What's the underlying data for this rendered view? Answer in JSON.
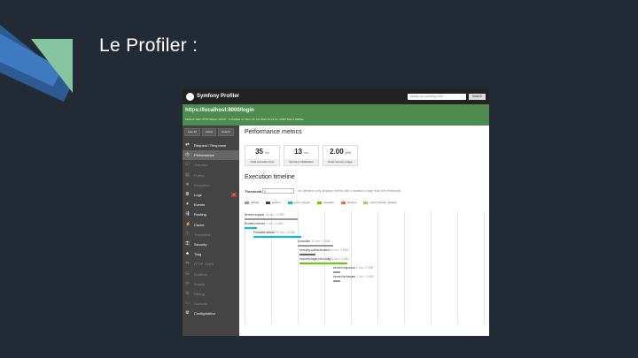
{
  "slide_title": "Le Profiler :",
  "profiler": {
    "logo_text": "Symfony Profiler",
    "search_placeholder": "search on symfony.com",
    "search_button": "Search",
    "url": "https://localhost:8000/login",
    "meta": "Method: GET   HTTP Status: 200   IP: ::1   Profiled on: Mon, 01 Jan 2022 10:21:31 +0000   Token: 8fd65a",
    "sidebar_buttons": [
      "Last 10",
      "Latest",
      "Search"
    ],
    "menu": [
      {
        "label": "Request / Response",
        "icon": "arrows-icon",
        "glyph": "⇄",
        "enabled": true,
        "active": false
      },
      {
        "label": "Performance",
        "icon": "clock-icon",
        "glyph": "◷",
        "enabled": true,
        "active": true
      },
      {
        "label": "Validator",
        "icon": "check-icon",
        "glyph": "☑",
        "enabled": false,
        "active": false
      },
      {
        "label": "Forms",
        "icon": "form-icon",
        "glyph": "▤",
        "enabled": false,
        "active": false
      },
      {
        "label": "Exception",
        "icon": "exception-icon",
        "glyph": "✱",
        "enabled": false,
        "active": false
      },
      {
        "label": "Logs",
        "icon": "logs-icon",
        "glyph": "≣",
        "enabled": true,
        "active": false,
        "badge": "2"
      },
      {
        "label": "Events",
        "icon": "events-icon",
        "glyph": "✶",
        "enabled": true,
        "active": false
      },
      {
        "label": "Routing",
        "icon": "routing-icon",
        "glyph": "⇶",
        "enabled": true,
        "active": false
      },
      {
        "label": "Cache",
        "icon": "cache-icon",
        "glyph": "⚡",
        "enabled": true,
        "active": false
      },
      {
        "label": "Translation",
        "icon": "translation-icon",
        "glyph": "Ⓣ",
        "enabled": false,
        "active": false
      },
      {
        "label": "Security",
        "icon": "security-icon",
        "glyph": "⚿",
        "enabled": true,
        "active": false
      },
      {
        "label": "Twig",
        "icon": "twig-icon",
        "glyph": "♣",
        "enabled": true,
        "active": false
      },
      {
        "label": "HTTP Client",
        "icon": "http-client-icon",
        "glyph": "⇆",
        "enabled": false,
        "active": false
      },
      {
        "label": "Doctrine",
        "icon": "database-icon",
        "glyph": "⛁",
        "enabled": false,
        "active": false
      },
      {
        "label": "Emails",
        "icon": "mail-icon",
        "glyph": "✉",
        "enabled": false,
        "active": false
      },
      {
        "label": "Debug",
        "icon": "debug-icon",
        "glyph": "⚙",
        "enabled": false,
        "active": false
      },
      {
        "label": "Console",
        "icon": "console-icon",
        "glyph": "▭",
        "enabled": false,
        "active": false
      },
      {
        "label": "Configuration",
        "icon": "config-icon",
        "glyph": "⚙",
        "enabled": true,
        "active": false
      }
    ],
    "performance": {
      "title": "Performance metrics",
      "metrics": [
        {
          "value": "35",
          "unit": "ms",
          "label": "Total execution time"
        },
        {
          "value": "13",
          "unit": "ms",
          "label": "Symfony initialization"
        },
        {
          "value": "2.00",
          "unit": "MiB",
          "label": "Peak memory usage"
        }
      ]
    },
    "timeline": {
      "title": "Execution timeline",
      "threshold_label": "Threshold",
      "threshold_value": "1",
      "threshold_help": "ms (timeline only displays events with a duration longer than this threshold)",
      "legend": [
        {
          "label": "default",
          "color": "#999999"
        },
        {
          "label": "section",
          "color": "#444444"
        },
        {
          "label": "event_listener",
          "color": "#00b8f5"
        },
        {
          "label": "template",
          "color": "#66cc00"
        },
        {
          "label": "doctrine",
          "color": "#ff6633"
        },
        {
          "label": "event_listener_loading",
          "color": "#aacd4e"
        }
      ],
      "events": [
        {
          "name": "kernel.request",
          "time": "15 ms / 2 MiB",
          "color": "#999999"
        },
        {
          "name": "RouterListener",
          "time": "1 ms / 2 MiB",
          "color": "#00b8f5"
        },
        {
          "name": "FirewallListener",
          "time": "10 ms / 2 MiB",
          "color": "#00b8f5"
        },
        {
          "name": "controller",
          "time": "10 ms / 2 MiB",
          "color": "#999999"
        },
        {
          "name": "security.authentication",
          "time": "5 ms / 2 MiB",
          "color": "#666666"
        },
        {
          "name": "security/login.html.twig",
          "time": "6 ms / 2 MiB",
          "color": "#66cc00"
        },
        {
          "name": "kernel.response",
          "time": "2 ms / 2 MiB",
          "color": "#999999"
        },
        {
          "name": "kernel.terminate",
          "time": "2 ms / 2 MiB",
          "color": "#999999"
        }
      ]
    }
  }
}
